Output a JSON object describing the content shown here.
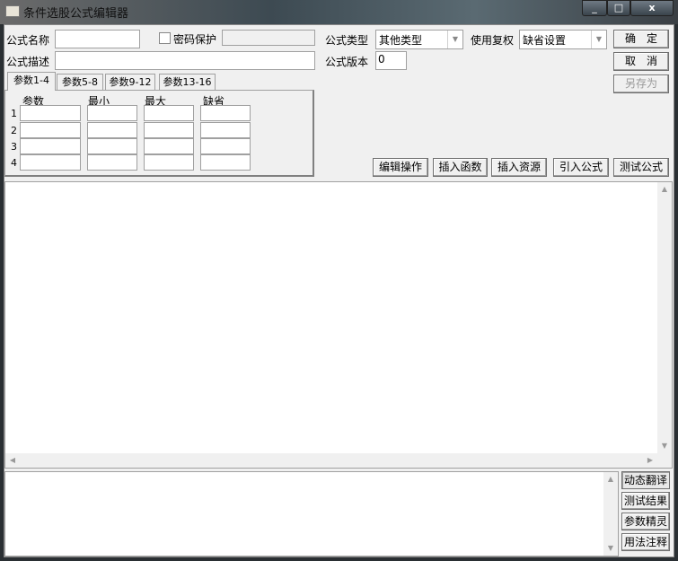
{
  "window": {
    "title": "条件选股公式编辑器",
    "controls": {
      "minimize": "_",
      "maximize": "□",
      "close": "x"
    }
  },
  "form": {
    "name_label": "公式名称",
    "name_value": "",
    "password_label": "密码保护",
    "password_checked": false,
    "password_value": "",
    "type_label": "公式类型",
    "type_value": "其他类型",
    "adjust_label": "使用复权",
    "adjust_value": "缺省设置",
    "desc_label": "公式描述",
    "desc_value": "",
    "version_label": "公式版本",
    "version_value": "0"
  },
  "buttons": {
    "ok": "确　定",
    "cancel": "取　消",
    "save_as": "另存为"
  },
  "tabs": [
    "参数1-4",
    "参数5-8",
    "参数9-12",
    "参数13-16"
  ],
  "params": {
    "headers": [
      "参数",
      "最小",
      "最大",
      "缺省"
    ],
    "rows": [
      "1",
      "2",
      "3",
      "4"
    ]
  },
  "toolbar": [
    "编辑操作",
    "插入函数",
    "插入资源",
    "引入公式",
    "测试公式"
  ],
  "side_buttons": [
    "动态翻译",
    "测试结果",
    "参数精灵",
    "用法注释"
  ]
}
